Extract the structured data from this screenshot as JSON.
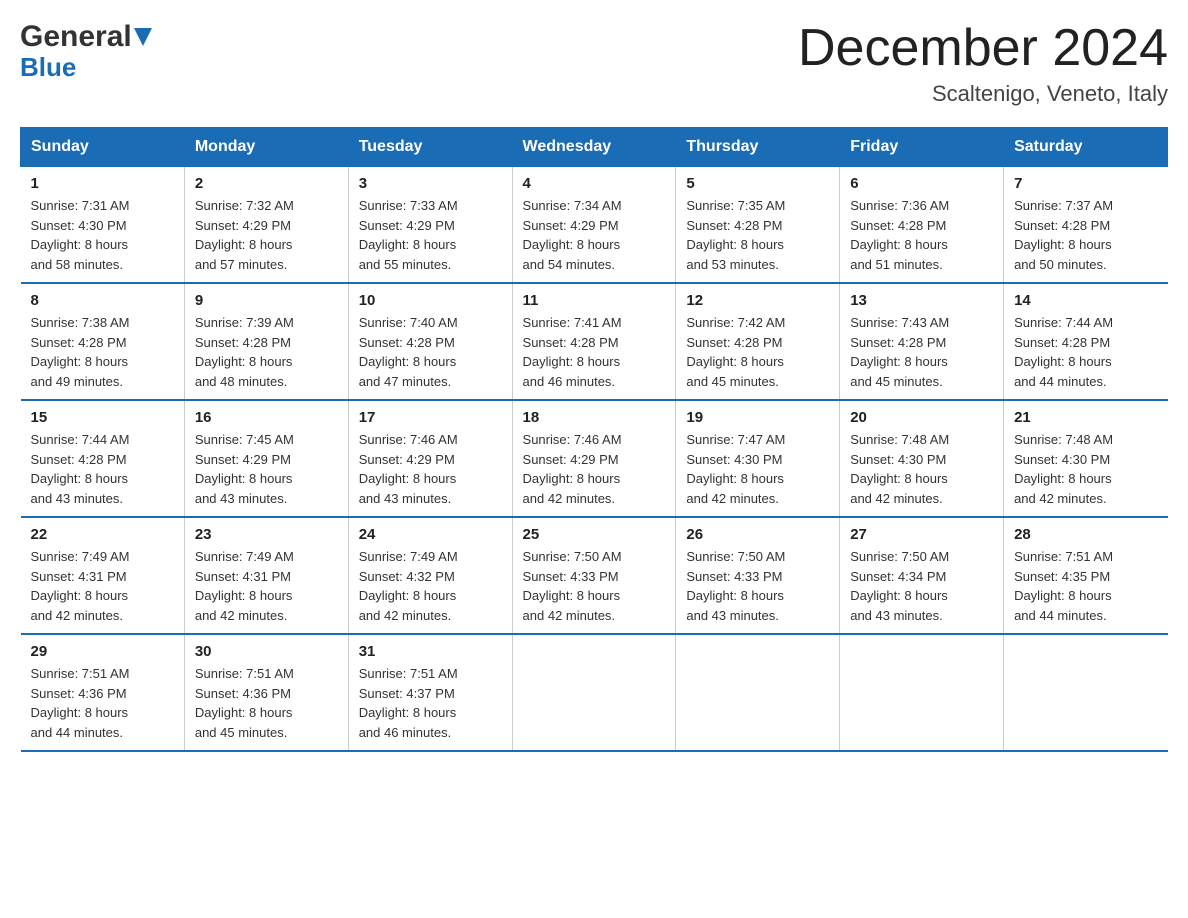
{
  "header": {
    "logo_general": "General",
    "logo_blue": "Blue",
    "month_title": "December 2024",
    "location": "Scaltenigo, Veneto, Italy"
  },
  "days_of_week": [
    "Sunday",
    "Monday",
    "Tuesday",
    "Wednesday",
    "Thursday",
    "Friday",
    "Saturday"
  ],
  "weeks": [
    [
      {
        "day": "1",
        "sunrise": "7:31 AM",
        "sunset": "4:30 PM",
        "daylight": "8 hours and 58 minutes."
      },
      {
        "day": "2",
        "sunrise": "7:32 AM",
        "sunset": "4:29 PM",
        "daylight": "8 hours and 57 minutes."
      },
      {
        "day": "3",
        "sunrise": "7:33 AM",
        "sunset": "4:29 PM",
        "daylight": "8 hours and 55 minutes."
      },
      {
        "day": "4",
        "sunrise": "7:34 AM",
        "sunset": "4:29 PM",
        "daylight": "8 hours and 54 minutes."
      },
      {
        "day": "5",
        "sunrise": "7:35 AM",
        "sunset": "4:28 PM",
        "daylight": "8 hours and 53 minutes."
      },
      {
        "day": "6",
        "sunrise": "7:36 AM",
        "sunset": "4:28 PM",
        "daylight": "8 hours and 51 minutes."
      },
      {
        "day": "7",
        "sunrise": "7:37 AM",
        "sunset": "4:28 PM",
        "daylight": "8 hours and 50 minutes."
      }
    ],
    [
      {
        "day": "8",
        "sunrise": "7:38 AM",
        "sunset": "4:28 PM",
        "daylight": "8 hours and 49 minutes."
      },
      {
        "day": "9",
        "sunrise": "7:39 AM",
        "sunset": "4:28 PM",
        "daylight": "8 hours and 48 minutes."
      },
      {
        "day": "10",
        "sunrise": "7:40 AM",
        "sunset": "4:28 PM",
        "daylight": "8 hours and 47 minutes."
      },
      {
        "day": "11",
        "sunrise": "7:41 AM",
        "sunset": "4:28 PM",
        "daylight": "8 hours and 46 minutes."
      },
      {
        "day": "12",
        "sunrise": "7:42 AM",
        "sunset": "4:28 PM",
        "daylight": "8 hours and 45 minutes."
      },
      {
        "day": "13",
        "sunrise": "7:43 AM",
        "sunset": "4:28 PM",
        "daylight": "8 hours and 45 minutes."
      },
      {
        "day": "14",
        "sunrise": "7:44 AM",
        "sunset": "4:28 PM",
        "daylight": "8 hours and 44 minutes."
      }
    ],
    [
      {
        "day": "15",
        "sunrise": "7:44 AM",
        "sunset": "4:28 PM",
        "daylight": "8 hours and 43 minutes."
      },
      {
        "day": "16",
        "sunrise": "7:45 AM",
        "sunset": "4:29 PM",
        "daylight": "8 hours and 43 minutes."
      },
      {
        "day": "17",
        "sunrise": "7:46 AM",
        "sunset": "4:29 PM",
        "daylight": "8 hours and 43 minutes."
      },
      {
        "day": "18",
        "sunrise": "7:46 AM",
        "sunset": "4:29 PM",
        "daylight": "8 hours and 42 minutes."
      },
      {
        "day": "19",
        "sunrise": "7:47 AM",
        "sunset": "4:30 PM",
        "daylight": "8 hours and 42 minutes."
      },
      {
        "day": "20",
        "sunrise": "7:48 AM",
        "sunset": "4:30 PM",
        "daylight": "8 hours and 42 minutes."
      },
      {
        "day": "21",
        "sunrise": "7:48 AM",
        "sunset": "4:30 PM",
        "daylight": "8 hours and 42 minutes."
      }
    ],
    [
      {
        "day": "22",
        "sunrise": "7:49 AM",
        "sunset": "4:31 PM",
        "daylight": "8 hours and 42 minutes."
      },
      {
        "day": "23",
        "sunrise": "7:49 AM",
        "sunset": "4:31 PM",
        "daylight": "8 hours and 42 minutes."
      },
      {
        "day": "24",
        "sunrise": "7:49 AM",
        "sunset": "4:32 PM",
        "daylight": "8 hours and 42 minutes."
      },
      {
        "day": "25",
        "sunrise": "7:50 AM",
        "sunset": "4:33 PM",
        "daylight": "8 hours and 42 minutes."
      },
      {
        "day": "26",
        "sunrise": "7:50 AM",
        "sunset": "4:33 PM",
        "daylight": "8 hours and 43 minutes."
      },
      {
        "day": "27",
        "sunrise": "7:50 AM",
        "sunset": "4:34 PM",
        "daylight": "8 hours and 43 minutes."
      },
      {
        "day": "28",
        "sunrise": "7:51 AM",
        "sunset": "4:35 PM",
        "daylight": "8 hours and 44 minutes."
      }
    ],
    [
      {
        "day": "29",
        "sunrise": "7:51 AM",
        "sunset": "4:36 PM",
        "daylight": "8 hours and 44 minutes."
      },
      {
        "day": "30",
        "sunrise": "7:51 AM",
        "sunset": "4:36 PM",
        "daylight": "8 hours and 45 minutes."
      },
      {
        "day": "31",
        "sunrise": "7:51 AM",
        "sunset": "4:37 PM",
        "daylight": "8 hours and 46 minutes."
      },
      null,
      null,
      null,
      null
    ]
  ],
  "labels": {
    "sunrise": "Sunrise:",
    "sunset": "Sunset:",
    "daylight": "Daylight:"
  }
}
